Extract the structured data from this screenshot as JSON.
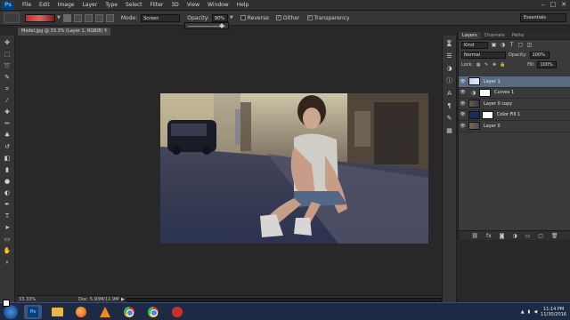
{
  "app": {
    "logo": "Ps"
  },
  "menubar": {
    "items": [
      "File",
      "Edit",
      "Image",
      "Layer",
      "Type",
      "Select",
      "Filter",
      "3D",
      "View",
      "Window",
      "Help"
    ],
    "window_controls": [
      "–",
      "□",
      "✕"
    ]
  },
  "options": {
    "mode_label": "Mode:",
    "mode_value": "Screen",
    "opacity_label": "Opacity:",
    "opacity_value": "90%",
    "reverse_label": "Reverse",
    "dither_label": "Dither",
    "transparency_label": "Transparency",
    "workspace": "Essentials"
  },
  "document": {
    "tab_title": "Model.jpg @ 33.3% (Layer 1, RGB/8) *",
    "close": "×"
  },
  "panel": {
    "tabs": [
      "Layers",
      "Channels",
      "Paths"
    ],
    "kind_label": "Kind",
    "blend_mode": "Normal",
    "opacity_label": "Opacity:",
    "opacity_value": "100%",
    "lock_label": "Lock:",
    "fill_label": "Fill:",
    "fill_value": "100%",
    "layers": [
      {
        "name": "Layer 1",
        "selected": true
      },
      {
        "name": "Curves 1",
        "selected": false
      },
      {
        "name": "Layer 0 copy",
        "selected": false
      },
      {
        "name": "Color Fill 1",
        "selected": false
      },
      {
        "name": "Layer 0",
        "selected": false
      }
    ]
  },
  "status": {
    "zoom": "33.33%",
    "doc_info": "Doc: 5.93M/11.9M"
  },
  "taskbar": {
    "ps_label": "Ps",
    "time": "11:14 PM",
    "date": "11/30/2016"
  }
}
